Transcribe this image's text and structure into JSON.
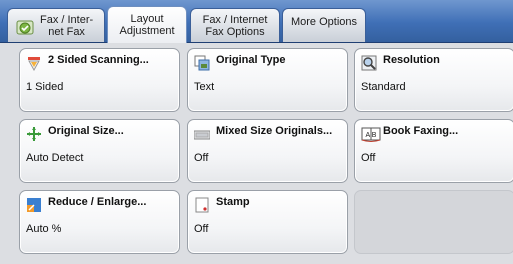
{
  "tabs": [
    {
      "label": "Fax / Inter-\nnet Fax",
      "active": false
    },
    {
      "label": "Layout\nAdjustment",
      "active": true
    },
    {
      "label": "Fax / Internet\nFax Options",
      "active": false
    },
    {
      "label": "More Options",
      "active": false
    }
  ],
  "buttons": [
    {
      "title": "2 Sided Scanning...",
      "value": "1 Sided",
      "icon": "two-sided-icon"
    },
    {
      "title": "Original Type",
      "value": "Text",
      "icon": "original-type-icon"
    },
    {
      "title": "Resolution",
      "value": "Standard",
      "icon": "resolution-icon"
    },
    {
      "title": "Original Size...",
      "value": "Auto Detect",
      "icon": "original-size-icon"
    },
    {
      "title": "Mixed Size Originals...",
      "value": "Off",
      "icon": "mixed-size-icon"
    },
    {
      "title": "Book Faxing...",
      "value": "Off",
      "icon": "book-faxing-icon"
    },
    {
      "title": "Reduce / Enlarge...",
      "value": "Auto %",
      "icon": "reduce-enlarge-icon"
    },
    {
      "title": "Stamp",
      "value": "Off",
      "icon": "stamp-icon"
    }
  ],
  "icon_glyphs": {
    "book": "A B"
  },
  "colors": {
    "tabbar": "#3f6fb6",
    "active_tab": "#ffffff"
  }
}
